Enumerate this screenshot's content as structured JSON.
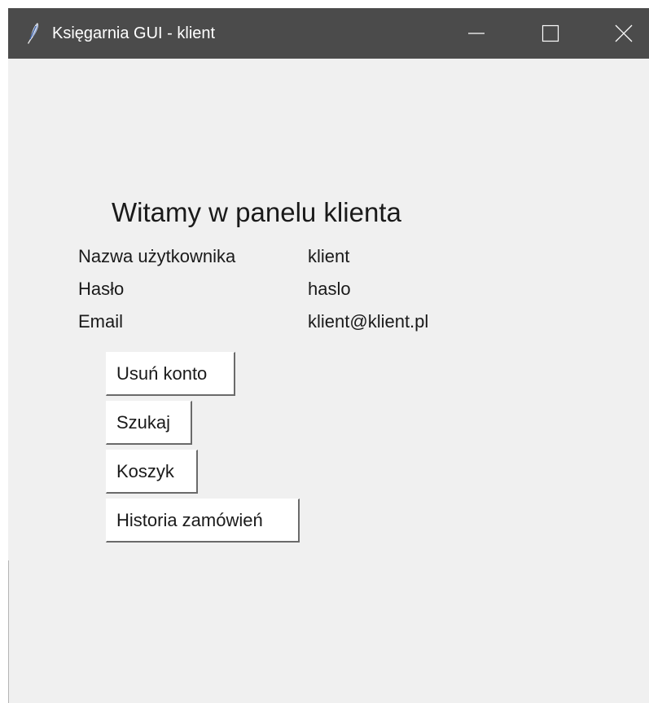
{
  "window": {
    "title": "Księgarnia GUI - klient",
    "controls": {
      "minimize_icon": "minimize-icon",
      "maximize_icon": "maximize-icon",
      "close_icon": "close-icon"
    },
    "colors": {
      "titlebar": "#4b4b4b",
      "background": "#f0f0f0"
    }
  },
  "main": {
    "heading": "Witamy w panelu klienta",
    "fields": [
      {
        "label": "Nazwa użytkownika",
        "value": "klient"
      },
      {
        "label": "Hasło",
        "value": "haslo"
      },
      {
        "label": "Email",
        "value": "klient@klient.pl"
      }
    ],
    "buttons": {
      "delete_account": "Usuń konto",
      "search": "Szukaj",
      "cart": "Koszyk",
      "order_history": "Historia zamówień"
    }
  }
}
